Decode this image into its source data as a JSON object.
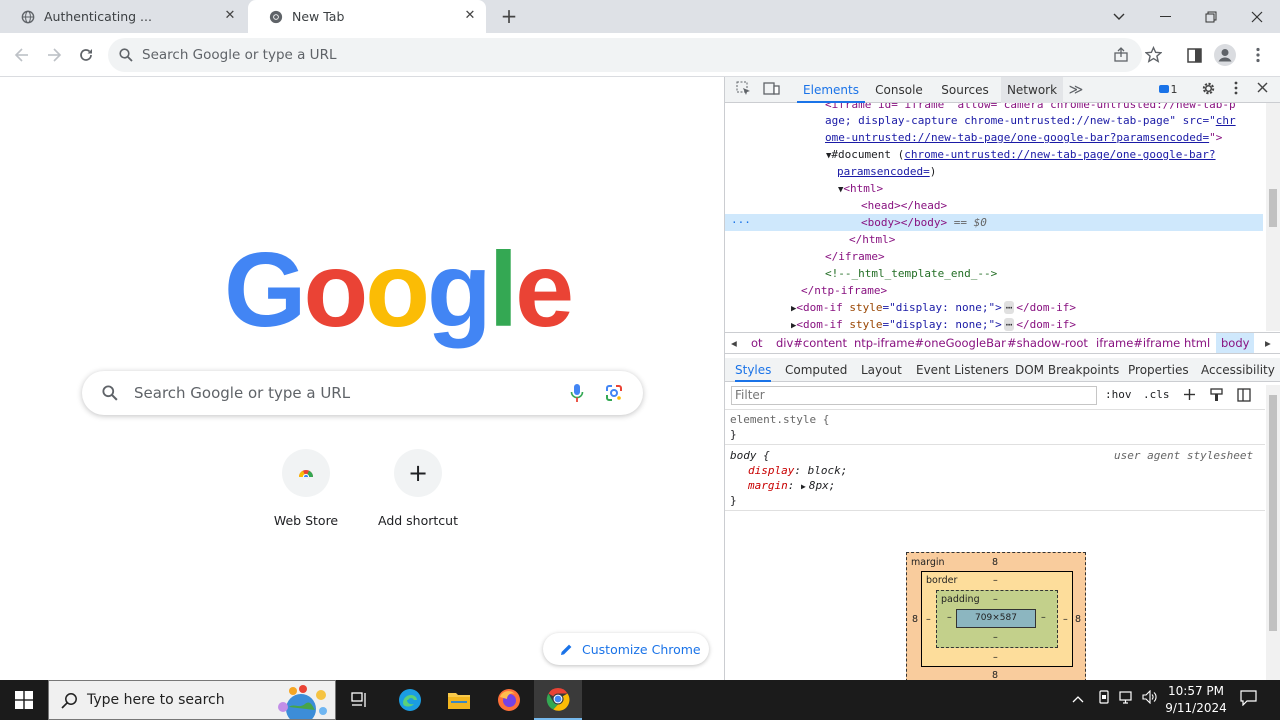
{
  "browser": {
    "tabs": [
      {
        "title": "Authenticating ...",
        "close": "✕"
      },
      {
        "title": "New Tab",
        "close": "✕"
      }
    ],
    "new_tab": "+",
    "window_controls": {
      "dropdown": "⌄",
      "minimize": "—",
      "restore": "❐",
      "close": "✕"
    },
    "omnibox_placeholder": "Search Google or type a URL"
  },
  "ntp": {
    "logo_letters": [
      "G",
      "o",
      "o",
      "g",
      "l",
      "e"
    ],
    "logo_colors": [
      "#4285f4",
      "#ea4335",
      "#fbbc05",
      "#4285f4",
      "#34a853",
      "#ea4335"
    ],
    "search_placeholder": "Search Google or type a URL",
    "shortcuts": [
      {
        "label": "Web Store"
      },
      {
        "label": "Add shortcut",
        "glyph": "+"
      }
    ],
    "customize_label": "Customize Chrome"
  },
  "devtools": {
    "tabs": [
      "Elements",
      "Console",
      "Sources",
      "Network"
    ],
    "more_tabs": "≫",
    "issues_count": "1",
    "dom": {
      "line1": "<iframe id=\"iframe\" allow=\"camera chrome-untrusted://new-tab-p",
      "line2a": "age; display-capture chrome-untrusted://new-tab-page\" src=\"",
      "line2b": "chr",
      "line3a": "ome-untrusted://new-tab-page/one-google-bar?paramsencoded=",
      "line3b": "\">",
      "line4a": "#document (",
      "line4b": "chrome-untrusted://new-tab-page/one-google-bar?",
      "line5a": "paramsencoded=",
      "line5b": ")",
      "line6": "<html>",
      "line7": "<head></head>",
      "line8a": "<body></body>",
      "line8b": " == $0",
      "line9": "</html>",
      "line10": "</iframe>",
      "line11": "<!--_html_template_end_-->",
      "line12": "</ntp-iframe>",
      "line13a": "<dom-if ",
      "line13b": "style",
      "line13c": "=\"display: none;\">",
      "line13d": "</dom-if>",
      "line14a": "<dom-if ",
      "line14b": "style",
      "line14c": "=\"display: none;\">",
      "line14d": "</dom-if>",
      "ellipsis": "···"
    },
    "breadcrumbs": [
      "ot",
      "div#content",
      "ntp-iframe#oneGoogleBar",
      "#shadow-root",
      "iframe#iframe",
      "html",
      "body"
    ],
    "sub_tabs": [
      "Styles",
      "Computed",
      "Layout",
      "Event Listeners",
      "DOM Breakpoints",
      "Properties",
      "Accessibility"
    ],
    "filter_placeholder": "Filter",
    "hov": ":hov",
    "cls": ".cls",
    "styles": {
      "element_style": "element.style {",
      "close1": "}",
      "body_sel": "body {",
      "ua": "user agent stylesheet",
      "prop1": "display",
      "val1": "block;",
      "prop2": "margin",
      "val2": "8px;",
      "close2": "}"
    },
    "box_model": {
      "margin_label": "margin",
      "margin_val": "8",
      "border_label": "border",
      "dash": "–",
      "padding_label": "padding",
      "content": "709×587"
    }
  },
  "taskbar": {
    "search_placeholder": "Type here to search",
    "time": "10:57 PM",
    "date": "9/11/2024"
  }
}
